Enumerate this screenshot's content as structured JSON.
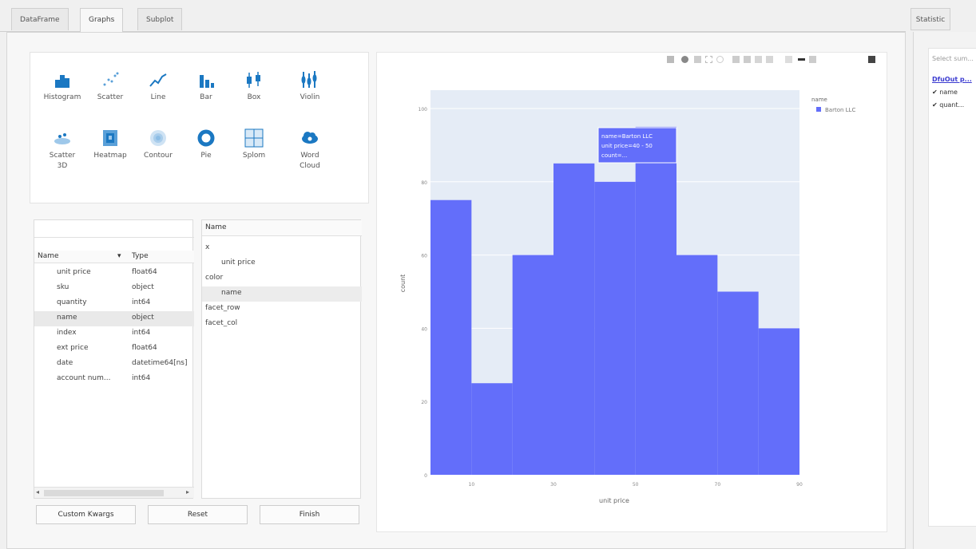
{
  "tabs": [
    "DataFrame",
    "Graphs",
    "Subplot"
  ],
  "right_tab": "Statistic",
  "plot_types": [
    {
      "label": "Histogram",
      "icon": "histogram-icon"
    },
    {
      "label": "Scatter",
      "icon": "scatter-icon"
    },
    {
      "label": "Line",
      "icon": "line-icon"
    },
    {
      "label": "Bar",
      "icon": "bar-icon"
    },
    {
      "label": "Box",
      "icon": "box-icon"
    },
    {
      "label": "Violin",
      "icon": "violin-icon"
    },
    {
      "label": "Scatter\n3D",
      "icon": "scatter3d-icon"
    },
    {
      "label": "Heatmap",
      "icon": "heatmap-icon"
    },
    {
      "label": "Contour",
      "icon": "contour-icon"
    },
    {
      "label": "Pie",
      "icon": "pie-icon"
    },
    {
      "label": "Splom",
      "icon": "splom-icon"
    },
    {
      "label": "Word\nCloud",
      "icon": "wordcloud-icon"
    }
  ],
  "columns": {
    "header_name": "Name",
    "header_type": "Type",
    "rows": [
      {
        "name": "unit price",
        "type": "float64"
      },
      {
        "name": "sku",
        "type": "object"
      },
      {
        "name": "quantity",
        "type": "int64"
      },
      {
        "name": "name",
        "type": "object"
      },
      {
        "name": "index",
        "type": "int64"
      },
      {
        "name": "ext price",
        "type": "float64"
      },
      {
        "name": "date",
        "type": "datetime64[ns]"
      },
      {
        "name": "account num...",
        "type": "int64"
      }
    ]
  },
  "mapping": {
    "header": "Name",
    "rows": [
      {
        "label": "x",
        "indent": false
      },
      {
        "label": "unit price",
        "indent": true
      },
      {
        "label": "color",
        "indent": false
      },
      {
        "label": "name",
        "indent": true
      },
      {
        "label": "facet_row",
        "indent": false
      },
      {
        "label": "facet_col",
        "indent": false
      }
    ]
  },
  "buttons": {
    "custom": "Custom Kwargs",
    "reset": "Reset",
    "finish": "Finish"
  },
  "colors": {
    "bar": "#636efa",
    "plot_bg": "#e5ecf6",
    "link": "#3a3ad0"
  },
  "right_panel": {
    "caption": "Select sum...",
    "link": "DfuOut p...",
    "checks": [
      "name",
      "quant..."
    ]
  },
  "chart_data": {
    "type": "bar",
    "x": [
      0,
      10,
      20,
      30,
      40,
      50,
      60,
      70,
      80,
      90
    ],
    "bin_width": 10,
    "values": [
      75,
      25,
      60,
      85,
      80,
      95,
      60,
      50,
      40
    ],
    "bin_starts": [
      0,
      10,
      20,
      30,
      40,
      50,
      60,
      70,
      80
    ],
    "xlim": [
      0,
      90
    ],
    "ylim": [
      0,
      105
    ],
    "xticks": [
      10,
      30,
      50,
      70,
      90
    ],
    "yticks": [
      0,
      20,
      40,
      60,
      80,
      100
    ],
    "xlabel": "unit price",
    "ylabel": "count",
    "grid": true,
    "legend": {
      "title": "name",
      "entries": [
        "Barton LLC"
      ],
      "placement": "top-right"
    },
    "hover": [
      "name=Barton LLC",
      "unit price=40 - 50",
      "count=..."
    ]
  }
}
